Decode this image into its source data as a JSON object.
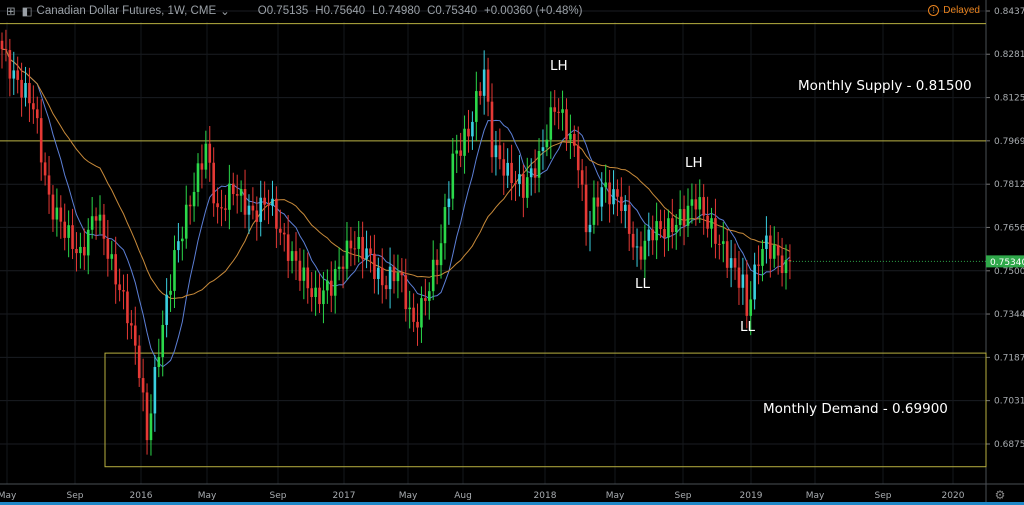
{
  "header": {
    "title": "Canadian Dollar Futures, 1W, CME",
    "open": "O0.75135",
    "high": "H0.75640",
    "low": "L0.74980",
    "close": "C0.75340",
    "change": "+0.00360 (+0.48%)",
    "status": "Delayed"
  },
  "colors": {
    "up": "#2bd84a",
    "up2": "#3ad0e0",
    "down": "#e53935",
    "level": "#b8b040",
    "ma_fast": "#5c7fd6",
    "ma_slow": "#c88a3a",
    "last": "#2fa84a"
  },
  "chart_data": {
    "type": "candlestick",
    "title": "Canadian Dollar Futures, 1W, CME",
    "last_price": "0.75340",
    "y_ticks": [
      "0.84375",
      "0.82815",
      "0.81250",
      "0.79690",
      "0.78125",
      "0.76565",
      "0.75000",
      "0.73440",
      "0.71875",
      "0.70315",
      "0.68750"
    ],
    "y_range": [
      0.6875,
      0.84375
    ],
    "x_ticks": [
      "May",
      "Sep",
      "2016",
      "May",
      "Sep",
      "2017",
      "May",
      "Aug",
      "2018",
      "May",
      "Sep",
      "2019",
      "May",
      "Sep",
      "2020"
    ],
    "close_path_weekly": [
      [
        0,
        0.83
      ],
      [
        3,
        0.82
      ],
      [
        8,
        0.81
      ],
      [
        12,
        0.775
      ],
      [
        16,
        0.765
      ],
      [
        20,
        0.755
      ],
      [
        24,
        0.772
      ],
      [
        28,
        0.752
      ],
      [
        32,
        0.735
      ],
      [
        35,
        0.715
      ],
      [
        37,
        0.69
      ],
      [
        40,
        0.722
      ],
      [
        44,
        0.755
      ],
      [
        48,
        0.775
      ],
      [
        52,
        0.795
      ],
      [
        55,
        0.77
      ],
      [
        59,
        0.78
      ],
      [
        64,
        0.77
      ],
      [
        68,
        0.776
      ],
      [
        72,
        0.76
      ],
      [
        76,
        0.75
      ],
      [
        80,
        0.74
      ],
      [
        84,
        0.745
      ],
      [
        89,
        0.76
      ],
      [
        93,
        0.757
      ],
      [
        97,
        0.745
      ],
      [
        101,
        0.75
      ],
      [
        105,
        0.73
      ],
      [
        108,
        0.74
      ],
      [
        112,
        0.76
      ],
      [
        115,
        0.79
      ],
      [
        119,
        0.8
      ],
      [
        123,
        0.822
      ],
      [
        125,
        0.795
      ],
      [
        129,
        0.785
      ],
      [
        133,
        0.78
      ],
      [
        137,
        0.79
      ],
      [
        141,
        0.81
      ],
      [
        143,
        0.805
      ],
      [
        147,
        0.79
      ],
      [
        149,
        0.765
      ],
      [
        153,
        0.78
      ],
      [
        158,
        0.775
      ],
      [
        162,
        0.755
      ],
      [
        166,
        0.765
      ],
      [
        170,
        0.765
      ],
      [
        174,
        0.77
      ],
      [
        177,
        0.776
      ],
      [
        181,
        0.765
      ],
      [
        185,
        0.755
      ],
      [
        189,
        0.745
      ],
      [
        190,
        0.735
      ],
      [
        193,
        0.755
      ],
      [
        195,
        0.76
      ],
      [
        198,
        0.755
      ],
      [
        200,
        0.75
      ],
      [
        201,
        0.7534
      ]
    ],
    "levels": [
      {
        "label": "Monthly Supply - 0.81500",
        "top": 0.8392,
        "bottom": 0.7969
      },
      {
        "label": "Monthly Demand - 0.69900",
        "top": 0.7203,
        "bottom": 0.6793
      }
    ],
    "annotations": [
      {
        "text": "LH",
        "week": 142,
        "price": 0.822
      },
      {
        "text": "LH",
        "week": 177,
        "price": 0.787
      },
      {
        "text": "LL",
        "week": 164,
        "price": 0.744
      },
      {
        "text": "LL",
        "week": 191,
        "price": 0.729
      }
    ]
  }
}
